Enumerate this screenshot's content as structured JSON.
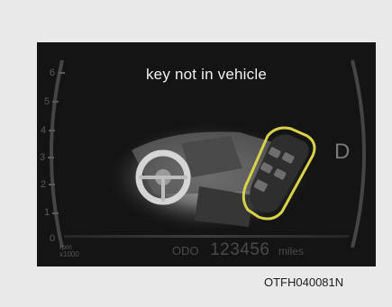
{
  "message": "key not in vehicle",
  "tach": {
    "scale": [
      "0",
      "1",
      "2",
      "3",
      "4",
      "5",
      "6"
    ],
    "unit_line1": "rpm",
    "unit_line2": "x1000"
  },
  "gear": "D",
  "odometer": {
    "label": "ODO",
    "value": "123456",
    "unit": "miles"
  },
  "figure_code": "OTFH040081N",
  "colors": {
    "highlight": "#d8d24a",
    "display_bg": "#141414",
    "page_bg": "#e9e9ea"
  }
}
